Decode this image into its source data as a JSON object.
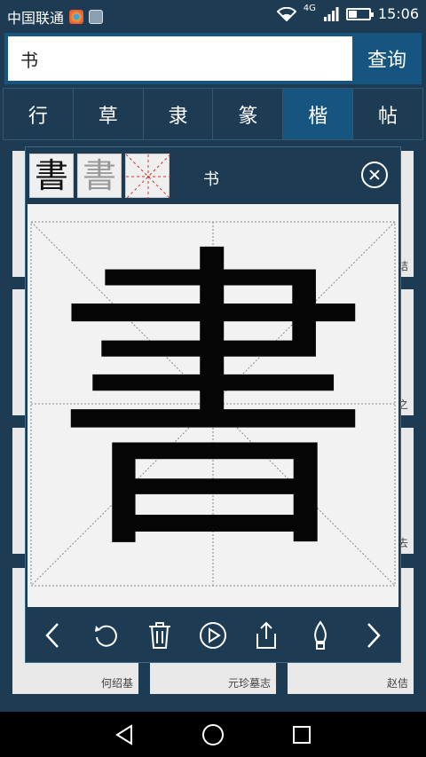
{
  "status": {
    "carrier": "中国联通",
    "network": "4G",
    "time": "15:06"
  },
  "search": {
    "value": "书",
    "button_label": "查询"
  },
  "tabs": [
    {
      "label": "行",
      "active": false
    },
    {
      "label": "草",
      "active": false
    },
    {
      "label": "隶",
      "active": false
    },
    {
      "label": "篆",
      "active": false
    },
    {
      "label": "楷",
      "active": true
    },
    {
      "label": "帖",
      "active": false
    }
  ],
  "results": {
    "calligraphers": [
      "何绍基",
      "元珍墓志",
      "赵佶"
    ],
    "partial_labels": [
      "诘",
      "之",
      "去"
    ]
  },
  "modal": {
    "title": "书",
    "glyph": "書",
    "thumbs": [
      "書",
      "書",
      ""
    ]
  },
  "colors": {
    "background": "#1d3b52",
    "accent": "#16557f"
  },
  "toolbar_icons": [
    "chevron-left-icon",
    "undo-icon",
    "trash-icon",
    "play-icon",
    "share-icon",
    "brush-icon",
    "chevron-right-icon"
  ]
}
